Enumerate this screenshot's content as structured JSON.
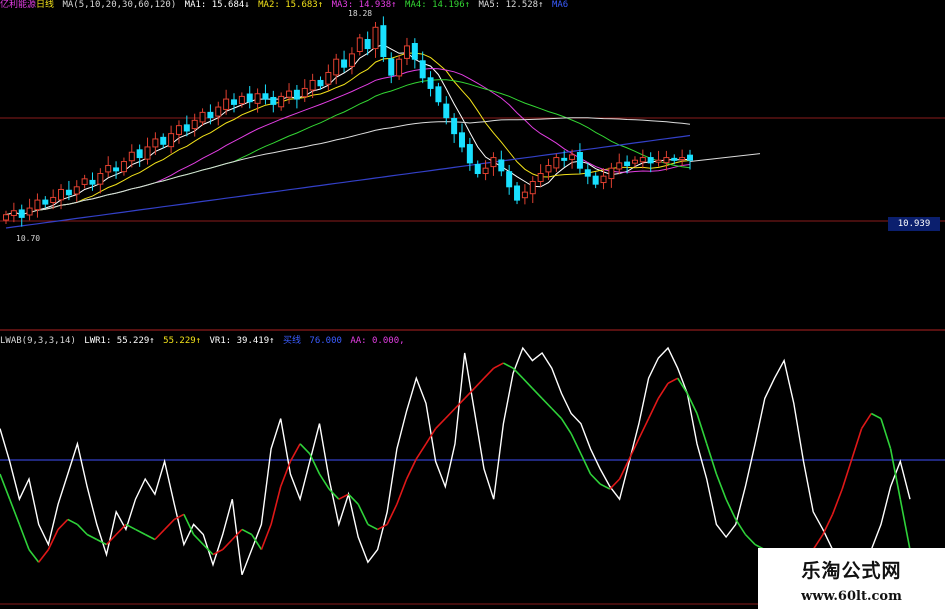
{
  "main_header": {
    "title": "亿利能源",
    "period": "日线",
    "ma_params": "MA(5,10,20,30,60,120)",
    "ma": [
      {
        "label": "MA1: 15.684↓",
        "color": "#ffffff"
      },
      {
        "label": "MA2: 15.683↑",
        "color": "#f2e21a"
      },
      {
        "label": "MA3: 14.938↑",
        "color": "#e23ee2"
      },
      {
        "label": "MA4: 14.196↑",
        "color": "#33d633"
      },
      {
        "label": "MA5: 12.528↑",
        "color": "#dcdcdc"
      },
      {
        "label": "MA6",
        "color": "#3a5cff"
      }
    ]
  },
  "price_labels": {
    "high": "18.28",
    "low": "10.70",
    "last": "10.939"
  },
  "indicator_header": {
    "name": "LWAB(9,3,3,14)",
    "items": [
      {
        "label": "LWR1: 55.229↑",
        "color": "#ffffff"
      },
      {
        "label": "55.229↑",
        "color": "#f2e21a"
      },
      {
        "label": "VR1: 39.419↑",
        "color": "#ffffff"
      },
      {
        "label": "买线",
        "color": "#3a5cff"
      },
      {
        "label": "76.000",
        "color": "#3a5cff"
      },
      {
        "label": "AA: 0.000,",
        "color": "#e23ee2"
      }
    ]
  },
  "watermark": {
    "cn": "乐淘公式网",
    "url": "www.60lt.com"
  },
  "colors": {
    "bg": "#000000",
    "up": "#e04030",
    "down": "#19e0ff",
    "grid": "#8a1d1d",
    "buy_line": "#3340c8",
    "indicator_white": "#ffffff",
    "indicator_red": "#e01818",
    "indicator_green": "#2fd23a"
  },
  "chart_data": [
    {
      "type": "candlestick",
      "title": "亿利能源 日线",
      "ylim": [
        10.3,
        18.5
      ],
      "closes": [
        10.95,
        11.1,
        10.85,
        11.2,
        11.5,
        11.35,
        11.6,
        11.9,
        11.7,
        12.0,
        12.3,
        12.1,
        12.5,
        12.8,
        12.6,
        12.95,
        13.3,
        13.1,
        13.5,
        13.8,
        13.6,
        14.0,
        14.3,
        14.1,
        14.5,
        14.8,
        14.6,
        15.0,
        15.3,
        15.1,
        15.4,
        15.2,
        15.5,
        15.3,
        15.1,
        15.4,
        15.6,
        15.3,
        15.7,
        16.0,
        15.8,
        16.3,
        16.8,
        16.5,
        17.0,
        17.6,
        17.2,
        18.0,
        16.9,
        16.2,
        16.8,
        17.3,
        16.8,
        16.1,
        15.7,
        15.2,
        14.6,
        14.0,
        13.5,
        12.9,
        12.5,
        12.7,
        13.1,
        12.6,
        12.0,
        11.5,
        11.8,
        12.2,
        12.5,
        12.8,
        13.1,
        13.0,
        13.2,
        12.7,
        12.4,
        12.1,
        12.4,
        12.7,
        12.9,
        12.8,
        13.0,
        13.1,
        12.9,
        13.0,
        13.1,
        13.0,
        13.1,
        13.0
      ],
      "ma_series": [
        "MA1",
        "MA2",
        "MA3",
        "MA4",
        "MA5",
        "MA6"
      ]
    },
    {
      "type": "line",
      "title": "LWAB(9,3,3,14)",
      "ylim": [
        0,
        100
      ],
      "buy_line": 76,
      "series": [
        {
          "name": "LWR1",
          "values": [
            68,
            55,
            40,
            48,
            30,
            22,
            38,
            50,
            62,
            45,
            30,
            18,
            35,
            28,
            40,
            48,
            42,
            55,
            38,
            22,
            30,
            26,
            14,
            26,
            40,
            10,
            20,
            30,
            60,
            72,
            50,
            40,
            55,
            70,
            48,
            30,
            42,
            25,
            15,
            20,
            35,
            60,
            75,
            88,
            78,
            55,
            45,
            62,
            98,
            75,
            52,
            40,
            70,
            90,
            100,
            95,
            98,
            92,
            82,
            74,
            70,
            60,
            52,
            45,
            40,
            55,
            70,
            88,
            96,
            100,
            92,
            82,
            62,
            48,
            30,
            25,
            30,
            45,
            62,
            80,
            88,
            95,
            78,
            55,
            35,
            28,
            20,
            12,
            8,
            10,
            20,
            30,
            45,
            55,
            40
          ]
        },
        {
          "name": "VR1",
          "values": [
            50,
            40,
            30,
            20,
            15,
            20,
            28,
            32,
            30,
            26,
            24,
            22,
            26,
            30,
            28,
            26,
            24,
            28,
            32,
            34,
            26,
            22,
            18,
            20,
            24,
            28,
            26,
            20,
            30,
            45,
            55,
            62,
            58,
            50,
            44,
            40,
            42,
            38,
            30,
            28,
            30,
            38,
            48,
            56,
            62,
            68,
            72,
            76,
            80,
            84,
            88,
            92,
            94,
            92,
            88,
            84,
            80,
            76,
            72,
            66,
            58,
            50,
            46,
            44,
            48,
            56,
            64,
            72,
            80,
            86,
            88,
            82,
            74,
            62,
            50,
            40,
            32,
            26,
            22,
            20,
            18,
            16,
            14,
            16,
            20,
            26,
            34,
            44,
            56,
            68,
            74,
            72,
            60,
            40,
            20
          ]
        }
      ]
    }
  ]
}
